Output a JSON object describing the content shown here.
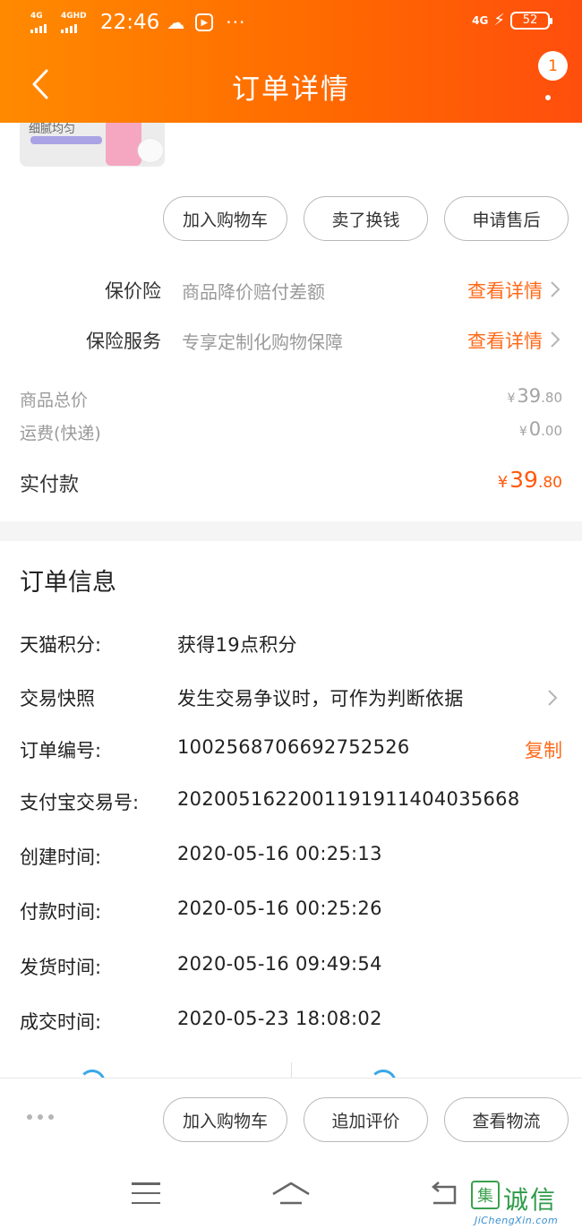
{
  "status_bar": {
    "net1": "4G",
    "net2": "4GHD",
    "time": "22:46",
    "more": "···",
    "net_right": "4G",
    "battery": "52"
  },
  "nav": {
    "title": "订单详情",
    "badge": "1"
  },
  "product": {
    "thumb_text": "细腻均匀"
  },
  "product_actions": [
    "加入购物车",
    "卖了换钱",
    "申请售后"
  ],
  "services": [
    {
      "label": "保价险",
      "desc": "商品降价赔付差额",
      "link": "查看详情"
    },
    {
      "label": "保险服务",
      "desc": "专享定制化购物保障",
      "link": "查看详情"
    }
  ],
  "prices": {
    "subtotal": {
      "label": "商品总价",
      "currency": "¥",
      "int": "39",
      "dec": ".80"
    },
    "shipping": {
      "label": "运费(快递)",
      "currency": "¥",
      "int": "0",
      "dec": ".00"
    },
    "paid": {
      "label": "实付款",
      "currency": "¥",
      "int": "39",
      "dec": ".80"
    }
  },
  "order_info": {
    "title": "订单信息",
    "rows": [
      {
        "key": "天猫积分:",
        "value": "获得19点积分"
      },
      {
        "key": "交易快照",
        "value": "发生交易争议时，可作为判断依据"
      },
      {
        "key": "订单编号:",
        "value": "1002568706692752526",
        "action": "复制"
      },
      {
        "key": "支付宝交易号:",
        "value": "2020051622001191911404035668"
      },
      {
        "key": "创建时间:",
        "value": "2020-05-16 00:25:13"
      },
      {
        "key": "付款时间:",
        "value": "2020-05-16 00:25:26"
      },
      {
        "key": "发货时间:",
        "value": "2020-05-16 09:49:54"
      },
      {
        "key": "成交时间:",
        "value": "2020-05-23 18:08:02"
      }
    ]
  },
  "bottom_actions": [
    "加入购物车",
    "追加评价",
    "查看物流"
  ],
  "watermark": {
    "cn": "诚信",
    "en": "JiChengXin.com",
    "box": "集"
  },
  "colors": {
    "brand_orange": "#ff6a00",
    "link_orange": "#ff6a1a",
    "price_orange": "#ff5a0c"
  },
  "icons": [
    "back-arrow-icon",
    "more-vertical-icon",
    "cloud-icon",
    "play-icon",
    "bolt-icon",
    "chevron-right-icon",
    "menu-icon",
    "home-icon",
    "return-icon"
  ]
}
